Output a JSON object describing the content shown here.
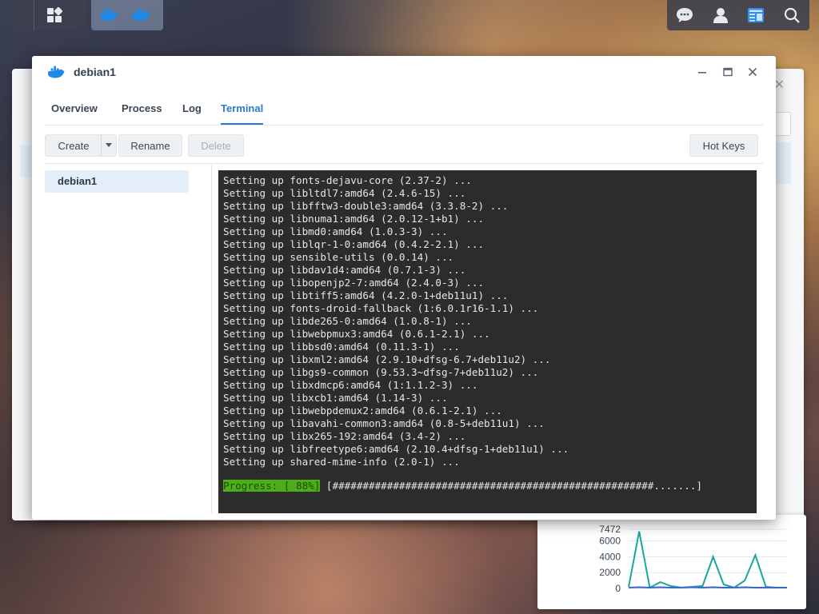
{
  "taskbar": {
    "left_icons": [
      "main-menu-icon"
    ],
    "running_apps": [
      "container-manager-icon",
      "container-manager-icon"
    ],
    "right_icons": [
      "chat-icon",
      "user-icon",
      "widgets-icon",
      "search-icon"
    ]
  },
  "window": {
    "title": "debian1",
    "icon": "docker-whale-icon"
  },
  "tabs": [
    {
      "label": "Overview"
    },
    {
      "label": "Process"
    },
    {
      "label": "Log"
    },
    {
      "label": "Terminal",
      "active": true
    }
  ],
  "toolbar": {
    "create": "Create",
    "rename": "Rename",
    "delete": "Delete",
    "hotkeys": "Hot Keys"
  },
  "sidebar": {
    "items": [
      {
        "label": "debian1"
      }
    ]
  },
  "terminal": {
    "lines": [
      "Setting up fonts-dejavu-core (2.37-2) ...",
      "Setting up libltdl7:amd64 (2.4.6-15) ...",
      "Setting up libfftw3-double3:amd64 (3.3.8-2) ...",
      "Setting up libnuma1:amd64 (2.0.12-1+b1) ...",
      "Setting up libmd0:amd64 (1.0.3-3) ...",
      "Setting up liblqr-1-0:amd64 (0.4.2-2.1) ...",
      "Setting up sensible-utils (0.0.14) ...",
      "Setting up libdav1d4:amd64 (0.7.1-3) ...",
      "Setting up libopenjp2-7:amd64 (2.4.0-3) ...",
      "Setting up libtiff5:amd64 (4.2.0-1+deb11u1) ...",
      "Setting up fonts-droid-fallback (1:6.0.1r16-1.1) ...",
      "Setting up libde265-0:amd64 (1.0.8-1) ...",
      "Setting up libwebpmux3:amd64 (0.6.1-2.1) ...",
      "Setting up libbsd0:amd64 (0.11.3-1) ...",
      "Setting up libxml2:amd64 (2.9.10+dfsg-6.7+deb11u2) ...",
      "Setting up libgs9-common (9.53.3~dfsg-7+deb11u2) ...",
      "Setting up libxdmcp6:amd64 (1:1.1.2-3) ...",
      "Setting up libxcb1:amd64 (1.14-3) ...",
      "Setting up libwebpdemux2:amd64 (0.6.1-2.1) ...",
      "Setting up libavahi-common3:amd64 (0.8-5+deb11u1) ...",
      "Setting up libx265-192:amd64 (3.4-2) ...",
      "Setting up libfreetype6:amd64 (2.10.4+dfsg-1+deb11u1) ...",
      "Setting up shared-mime-info (2.0-1) ..."
    ],
    "progress_label": "Progress: [ 88%]",
    "progress_bar": " [#####################################################.......]",
    "progress_percent": 88
  },
  "chart_data": {
    "type": "line",
    "title": "",
    "xlabel": "",
    "ylabel": "",
    "y_ticks": [
      "7472",
      "6000",
      "4000",
      "2000",
      "0"
    ],
    "ylim": [
      0,
      7472
    ],
    "series": [
      {
        "color": "#1aa79b",
        "values": [
          200,
          7200,
          100,
          800,
          300,
          100,
          200,
          300,
          4000,
          500,
          100,
          1000,
          4200,
          200,
          100,
          100
        ]
      },
      {
        "color": "#3d66c9",
        "values": [
          100,
          150,
          100,
          150,
          100,
          100,
          150,
          100,
          150,
          100,
          100,
          150,
          100,
          100,
          100,
          100
        ]
      }
    ]
  },
  "colors": {
    "accent": "#2f7ac7",
    "terminal_bg": "#2c2c2c",
    "progress_green": "#4caf1a"
  }
}
